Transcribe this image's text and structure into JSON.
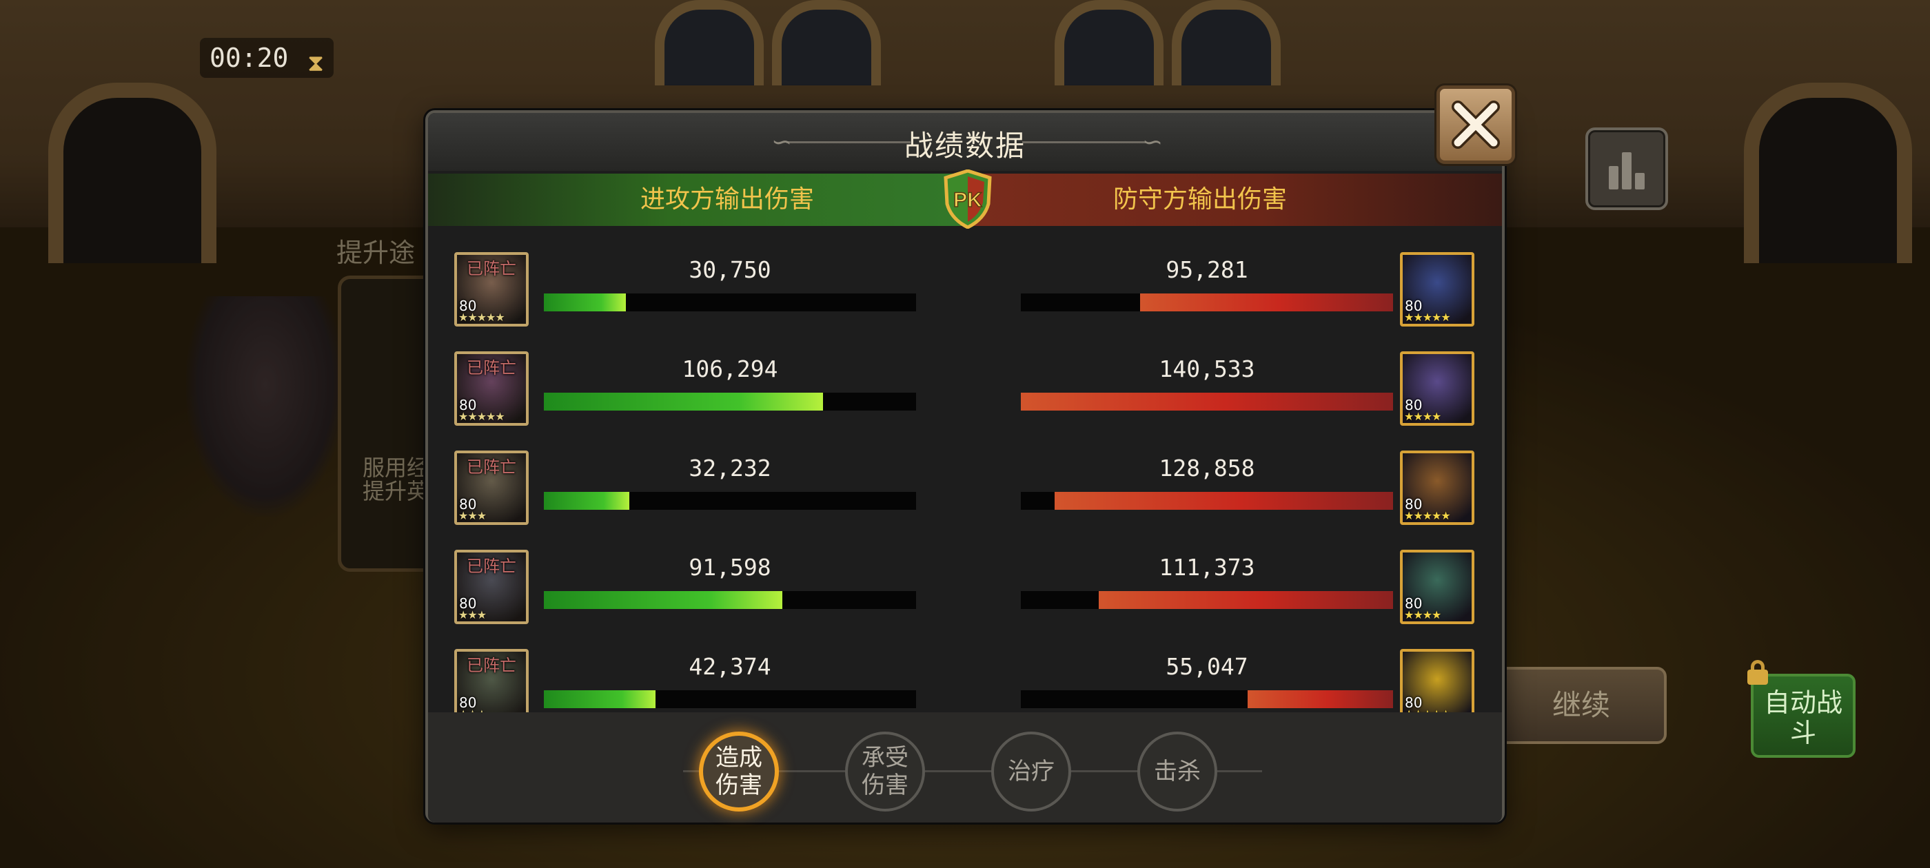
{
  "timer": "00:20",
  "modal_title": "战绩数据",
  "attacker_label": "进攻方输出伤害",
  "defender_label": "防守方输出伤害",
  "pk_label": "PK",
  "dead_label": "已阵亡",
  "attackers": [
    {
      "value": "30,750",
      "fill": 0.22,
      "level": "80",
      "dead": true,
      "stars": "★★★★★",
      "color": "#8a5a3a"
    },
    {
      "value": "106,294",
      "fill": 0.75,
      "level": "80",
      "dead": true,
      "stars": "★★★★★",
      "color": "#7a3a6a"
    },
    {
      "value": "32,232",
      "fill": 0.23,
      "level": "80",
      "dead": true,
      "stars": "★★★",
      "color": "#6a5a3a"
    },
    {
      "value": "91,598",
      "fill": 0.64,
      "level": "80",
      "dead": true,
      "stars": "★★★",
      "color": "#4a4a5a"
    },
    {
      "value": "42,374",
      "fill": 0.3,
      "level": "80",
      "dead": true,
      "stars": "★★★",
      "color": "#4a5a3a"
    }
  ],
  "defenders": [
    {
      "value": "95,281",
      "fill": 0.68,
      "level": "80",
      "stars": "★★★★★",
      "color": "#3a4a8a"
    },
    {
      "value": "140,533",
      "fill": 1.0,
      "level": "80",
      "stars": "★★★★",
      "color": "#5a4a8a"
    },
    {
      "value": "128,858",
      "fill": 0.91,
      "level": "80",
      "stars": "★★★★★",
      "color": "#8a5a2a"
    },
    {
      "value": "111,373",
      "fill": 0.79,
      "level": "80",
      "stars": "★★★★",
      "color": "#3a6a5a"
    },
    {
      "value": "55,047",
      "fill": 0.39,
      "level": "80",
      "stars": "★★★★★",
      "color": "#c8a020"
    }
  ],
  "tabs": [
    {
      "label": "造成伤害",
      "active": true
    },
    {
      "label": "承受伤害",
      "active": false
    },
    {
      "label": "治疗",
      "active": false
    },
    {
      "label": "击杀",
      "active": false
    }
  ],
  "background": {
    "left_text_1": "提升途",
    "left_text_2": "服用经",
    "left_text_3": "提升英",
    "continue_label": "继续",
    "auto_battle_label": "自动战斗"
  },
  "colors": {
    "accent_gold": "#f2c44c",
    "bar_green": "#42c22a",
    "bar_red": "#c8281e",
    "tab_active": "#f0a224",
    "dead_red": "#ff5a55"
  },
  "icons": [
    "close-icon",
    "pk-shield-icon",
    "bar-chart-icon",
    "hourglass-icon",
    "lock-icon",
    "star-icon"
  ]
}
